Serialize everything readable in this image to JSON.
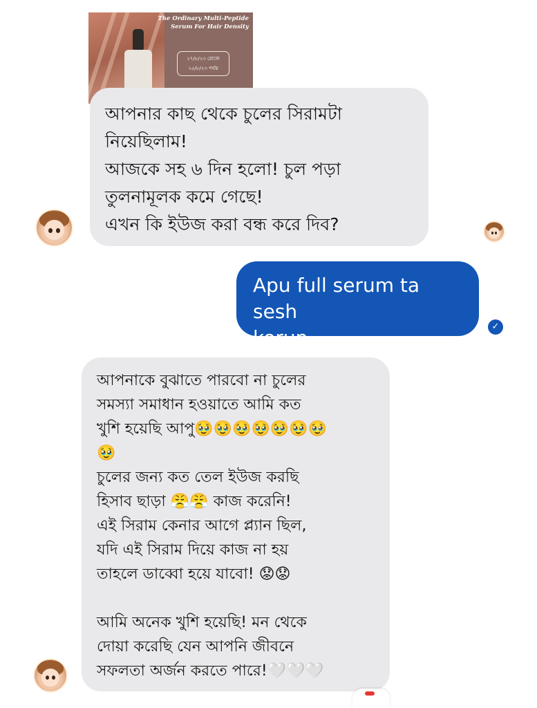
{
  "product_card": {
    "title": "The Ordinary Multi-Peptide\nSerum For Hair Density",
    "dates": "২৭/৮/২৩ রোজে\n২৫/৮/২৩ পর্যন্ত"
  },
  "messages": [
    {
      "direction": "incoming",
      "text": "আপনার কাছ থেকে চুলের সিরামটা\nনিয়েছিলাম!\nআজকে সহ ৬ দিন হলো! চুল পড়া\nতুলনামূলক কমে গেছে!\nএখন কি ইউজ করা বন্ধ করে দিব?"
    },
    {
      "direction": "outgoing",
      "text": "Apu full serum ta sesh\nkorun ."
    },
    {
      "direction": "incoming",
      "text": "আপনাকে বুঝাতে পারবো না চুলের\nসমস্যা সমাধান হওয়াতে আমি কত\nখুশি হয়েছি আপু🥹🥹🥹🥹🥹🥹🥹\n🥹\nচুলের জন্য কত তেল ইউজ করছি\nহিসাব ছাড়া 😤😤 কাজ করেনি!\nএই সিরাম কেনার আগে প্ল্যান ছিল,\nযদি এই সিরাম দিয়ে কাজ না হয়\nতাহলে ডাব্বো হয়ে যাবো! 😟😟\n\nআমি অনেক খুশি হয়েছি! মন থেকে\nদোয়া করেছি যেন আপনি জীবনে\nসফলতা অর্জন করতে পারে!🤍🤍🤍"
    }
  ],
  "read_receipt": "✓"
}
